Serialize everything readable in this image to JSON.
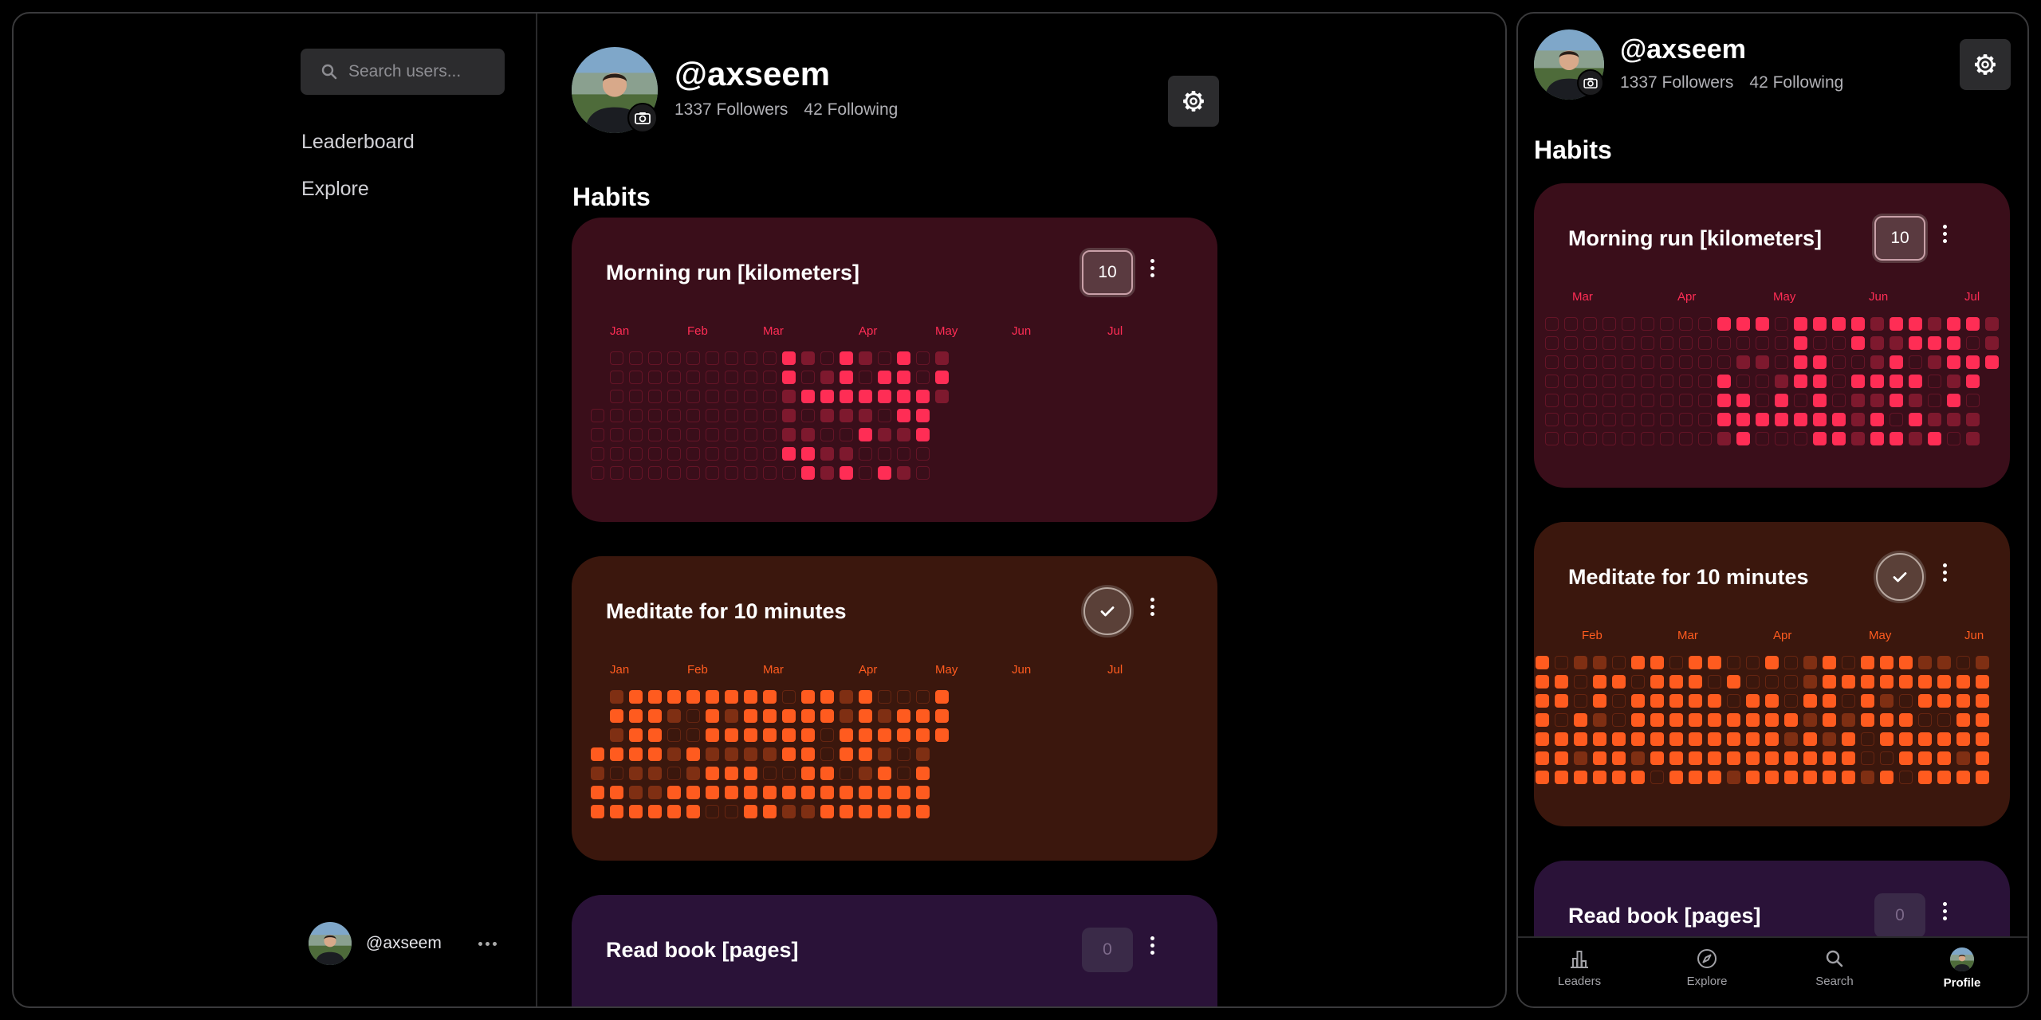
{
  "colors": {
    "run": "#ff2d55",
    "meditate": "#ff5b1f",
    "read": "#8e44ad"
  },
  "user": {
    "handle": "@axseem",
    "followers": "1337 Followers",
    "following": "42 Following"
  },
  "sidebar": {
    "search_placeholder": "Search users...",
    "items": [
      {
        "label": "Leaderboard"
      },
      {
        "label": "Explore"
      }
    ]
  },
  "habits_title": "Habits",
  "desktop": {
    "habits": [
      {
        "title": "Morning run [kilometers]",
        "control": "counter",
        "count": "10",
        "months": [
          "Jan",
          "Feb",
          "Mar",
          "Apr",
          "May",
          "Jun",
          "Jul"
        ]
      },
      {
        "title": "Meditate for 10 minutes",
        "control": "check",
        "months": [
          "Jan",
          "Feb",
          "Mar",
          "Apr",
          "May",
          "Jun",
          "Jul"
        ]
      },
      {
        "title": "Read book [pages]",
        "control": "counter",
        "count": "0"
      }
    ]
  },
  "mobile": {
    "habits": [
      {
        "title": "Morning run [kilometers]",
        "control": "counter",
        "count": "10",
        "months": [
          "Mar",
          "Apr",
          "May",
          "Jun",
          "Jul"
        ]
      },
      {
        "title": "Meditate for 10 minutes",
        "control": "check",
        "months": [
          "Feb",
          "Mar",
          "Apr",
          "May",
          "Jun"
        ]
      },
      {
        "title": "Read book [pages]",
        "control": "counter",
        "count": "0"
      }
    ],
    "tabs": [
      {
        "label": "Leaders",
        "icon": "bar-chart-icon"
      },
      {
        "label": "Explore",
        "icon": "compass-icon"
      },
      {
        "label": "Search",
        "icon": "search-icon"
      },
      {
        "label": "Profile",
        "icon": "avatar"
      }
    ]
  }
}
